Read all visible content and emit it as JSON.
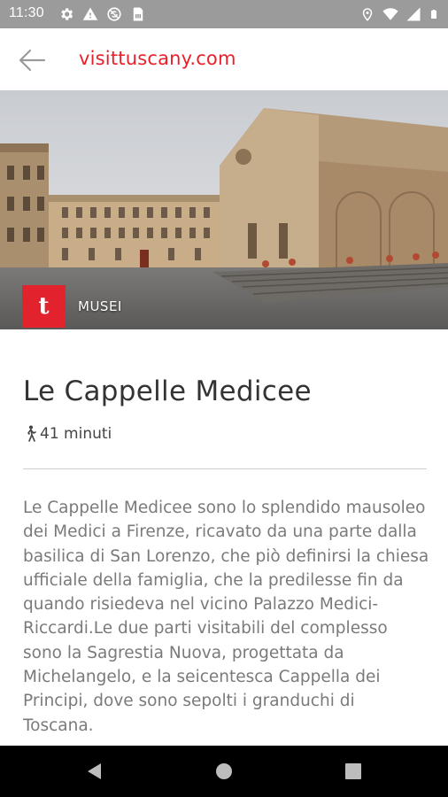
{
  "status_bar": {
    "time": "11:30",
    "left_icons": [
      "gear-icon",
      "alert-icon",
      "sync-icon",
      "sim-card-icon"
    ],
    "right_icons": [
      "location-icon",
      "wifi-icon",
      "signal-icon",
      "battery-icon"
    ]
  },
  "app_bar": {
    "back_icon": "arrow-back-icon",
    "site_title": "visittuscany.com"
  },
  "hero": {
    "category_logo_letter": "t",
    "category_label": "MUSEI"
  },
  "poi": {
    "title": "Le Cappelle Medicee",
    "duration_icon": "walking-icon",
    "duration": "41 minuti",
    "description": "Le Cappelle Medicee sono lo splendido mausoleo dei Medici a Firenze, ricavato da una parte dalla basilica di San Lorenzo, che piò definirsi la chiesa ufficiale della famiglia, che la predilesse fin da quando risiedeva nel vicino Palazzo Medici-Riccardi.Le due parti visitabili del complesso sono la Sagrestia Nuova, progettata da Michelangelo, e la seicentesca Cappella dei Principi, dove sono sepolti i granduchi di Toscana."
  },
  "nav_bar": {
    "back": "nav-back-icon",
    "home": "nav-home-icon",
    "recents": "nav-recents-icon"
  },
  "colors": {
    "brand_red": "#e2232e",
    "title_red": "#e8202a",
    "status_bar": "#9b9b9b",
    "text_dark": "#333333",
    "text_body": "#7a7a7a"
  }
}
